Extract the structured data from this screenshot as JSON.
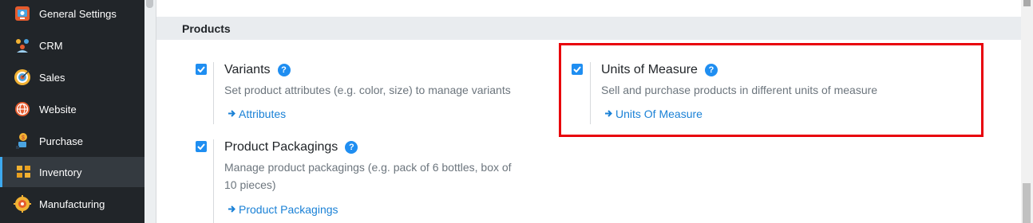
{
  "sidebar": {
    "items": [
      {
        "label": "General Settings",
        "icon": "settings-icon"
      },
      {
        "label": "CRM",
        "icon": "crm-icon"
      },
      {
        "label": "Sales",
        "icon": "sales-icon"
      },
      {
        "label": "Website",
        "icon": "website-icon"
      },
      {
        "label": "Purchase",
        "icon": "purchase-icon"
      },
      {
        "label": "Inventory",
        "icon": "inventory-icon",
        "active": true
      },
      {
        "label": "Manufacturing",
        "icon": "manufacturing-icon"
      }
    ]
  },
  "section": {
    "title": "Products"
  },
  "settings": {
    "variants": {
      "title": "Variants",
      "checked": true,
      "description": "Set product attributes (e.g. color, size) to manage variants",
      "link": "Attributes"
    },
    "uom": {
      "title": "Units of Measure",
      "checked": true,
      "description": "Sell and purchase products in different units of measure",
      "link": "Units Of Measure"
    },
    "packagings": {
      "title": "Product Packagings",
      "checked": true,
      "description_line1": "Manage product packagings (e.g. pack of 6 bottles, box of",
      "description_line2": "10 pieces)",
      "link": "Product Packagings"
    }
  },
  "colors": {
    "accent": "#1f8ef1",
    "link": "#1a81d6",
    "highlight": "#e8000b",
    "sidebar_bg": "#212529"
  }
}
